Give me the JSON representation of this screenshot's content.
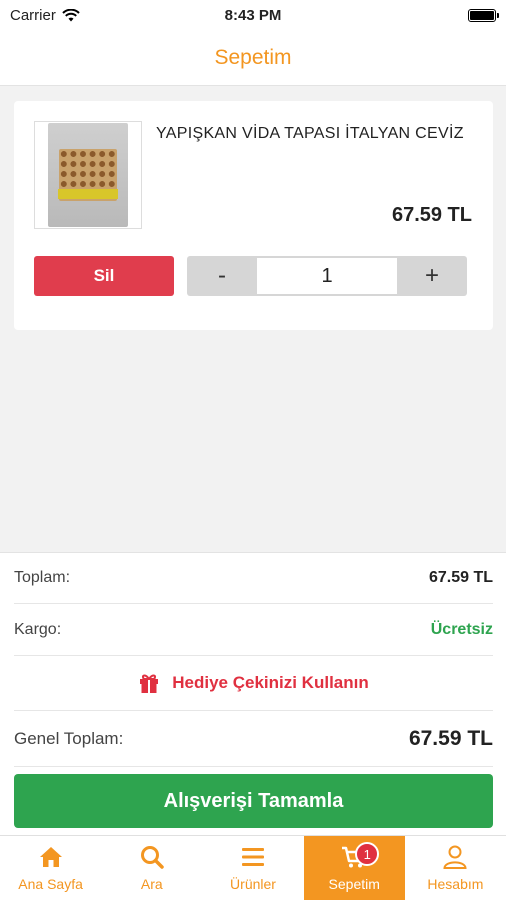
{
  "status_bar": {
    "carrier": "Carrier",
    "time": "8:43 PM"
  },
  "nav": {
    "title": "Sepetim"
  },
  "cart": {
    "items": [
      {
        "name": "YAPIŞKAN VİDA TAPASI İTALYAN CEVİZ",
        "price": "67.59 TL",
        "quantity": "1"
      }
    ],
    "delete_label": "Sil",
    "minus_label": "-",
    "plus_label": "+"
  },
  "summary": {
    "total_label": "Toplam:",
    "total_value": "67.59 TL",
    "shipping_label": "Kargo:",
    "shipping_value": "Ücretsiz",
    "gift_label": "Hediye Çekinizi Kullanın",
    "grand_total_label": "Genel Toplam:",
    "grand_total_value": "67.59 TL",
    "checkout_label": "Alışverişi Tamamla"
  },
  "tabs": [
    {
      "label": "Ana Sayfa",
      "icon": "home-icon"
    },
    {
      "label": "Ara",
      "icon": "search-icon"
    },
    {
      "label": "Ürünler",
      "icon": "menu-icon"
    },
    {
      "label": "Sepetim",
      "icon": "cart-icon",
      "active": true,
      "badge": "1"
    },
    {
      "label": "Hesabım",
      "icon": "user-icon"
    }
  ],
  "colors": {
    "accent": "#f39621",
    "danger": "#e03d4d",
    "success": "#2ea44f"
  }
}
